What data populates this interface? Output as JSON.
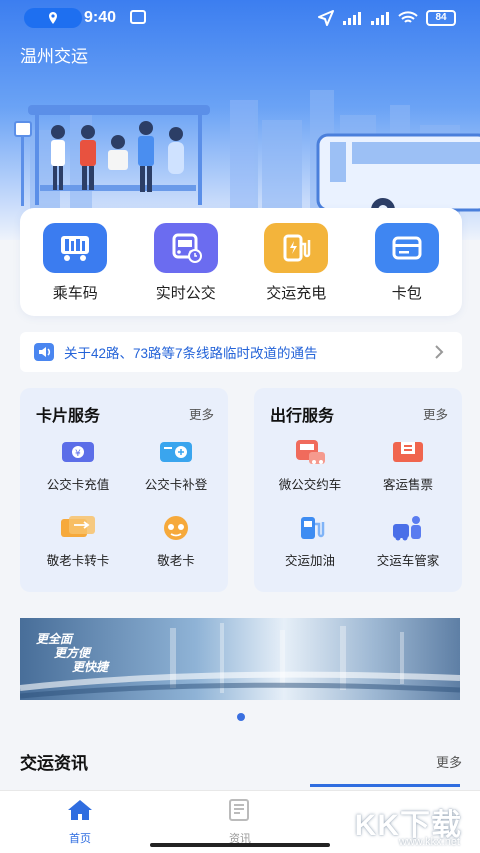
{
  "status_bar": {
    "time": "9:40",
    "battery": "84"
  },
  "header": {
    "title": "温州交运"
  },
  "quick_actions": [
    {
      "label": "乘车码",
      "icon": "qr-code-bus-icon",
      "color": "#3b7cf0"
    },
    {
      "label": "实时公交",
      "icon": "realtime-bus-icon",
      "color": "#6b6cf0"
    },
    {
      "label": "交运充电",
      "icon": "charging-station-icon",
      "color": "#f3b43b"
    },
    {
      "label": "卡包",
      "icon": "card-wallet-icon",
      "color": "#3f86f2"
    }
  ],
  "notice": {
    "text": "关于42路、73路等7条线路临时改道的通告"
  },
  "card_services": {
    "title": "卡片服务",
    "more": "更多",
    "items": [
      {
        "label": "公交卡充值",
        "icon": "card-recharge-icon"
      },
      {
        "label": "公交卡补登",
        "icon": "card-register-icon"
      },
      {
        "label": "敬老卡转卡",
        "icon": "senior-card-transfer-icon"
      },
      {
        "label": "敬老卡",
        "icon": "senior-card-icon"
      }
    ]
  },
  "travel_services": {
    "title": "出行服务",
    "more": "更多",
    "items": [
      {
        "label": "微公交约车",
        "icon": "micro-bus-booking-icon"
      },
      {
        "label": "客运售票",
        "icon": "ticket-sale-icon"
      },
      {
        "label": "交运加油",
        "icon": "fuel-pump-icon"
      },
      {
        "label": "交运车管家",
        "icon": "car-butler-icon"
      }
    ]
  },
  "banner": {
    "lines": [
      "更全面",
      "更方便",
      "更快捷"
    ]
  },
  "news": {
    "title": "交运资讯",
    "more": "更多"
  },
  "tabbar": {
    "home": "首页",
    "news": "资讯"
  },
  "watermark": {
    "text": "KK下载",
    "url": "www.kkx.net"
  },
  "colors": {
    "primary": "#2f6de0",
    "notice_text": "#2463d8",
    "panel_bg": "#e9effb"
  }
}
